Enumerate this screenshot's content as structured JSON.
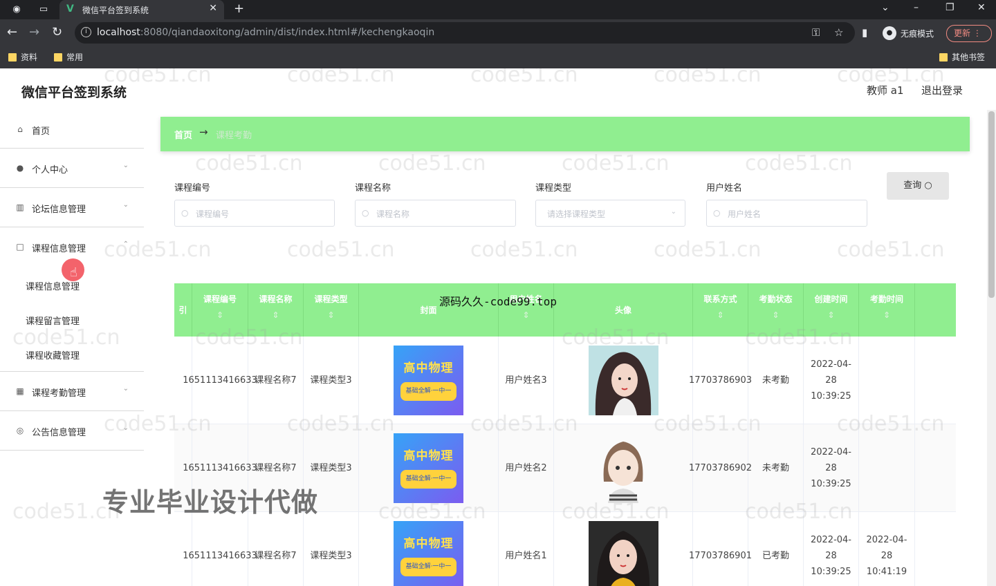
{
  "browser": {
    "tab_title": "微信平台签到系统",
    "url_host": "localhost",
    "url_rest": ":8080/qiandaoxitong/admin/dist/index.html#/kechengkaoqin",
    "incognito_label": "无痕模式",
    "update_label": "更新",
    "bookmarks": [
      "资料",
      "常用"
    ],
    "other_bookmarks": "其他书签"
  },
  "header": {
    "brand": "微信平台签到系统",
    "user": "教师 a1",
    "logout": "退出登录"
  },
  "sidebar": {
    "items": [
      {
        "label": "首页",
        "icon": "home-icon"
      },
      {
        "label": "个人中心",
        "icon": "user-icon"
      },
      {
        "label": "论坛信息管理",
        "icon": "chart-icon"
      },
      {
        "label": "课程信息管理",
        "icon": "square-icon"
      }
    ],
    "subitems": [
      "课程信息管理",
      "课程留言管理",
      "课程收藏管理"
    ],
    "items_after": [
      {
        "label": "课程考勤管理",
        "icon": "grid-icon"
      },
      {
        "label": "公告信息管理",
        "icon": "globe-icon"
      }
    ]
  },
  "breadcrumb": {
    "home": "首页",
    "arrow": "→",
    "current": "课程考勤"
  },
  "filters": {
    "course_no": {
      "label": "课程编号",
      "placeholder": "课程编号"
    },
    "course_name": {
      "label": "课程名称",
      "placeholder": "课程名称"
    },
    "course_type": {
      "label": "课程类型",
      "placeholder": "请选择课程类型"
    },
    "user_name": {
      "label": "用户姓名",
      "placeholder": "用户姓名"
    },
    "query": "查询"
  },
  "table": {
    "headers": [
      "引",
      "课程编号",
      "课程名称",
      "课程类型",
      "封面",
      "用户姓名",
      "头像",
      "联系方式",
      "考勤状态",
      "创建时间",
      "考勤时间"
    ],
    "rows": [
      {
        "course_no": "1651113416633",
        "course_name": "课程名称7",
        "course_type": "课程类型3",
        "cover_title": "高中物理",
        "cover_badge": "基础全解·一中一",
        "user_name": "用户姓名3",
        "phone": "17703786903",
        "status": "未考勤",
        "created": "2022-04-28 10:39:25",
        "checkin": ""
      },
      {
        "course_no": "1651113416633",
        "course_name": "课程名称7",
        "course_type": "课程类型3",
        "cover_title": "高中物理",
        "cover_badge": "基础全解·一中一",
        "user_name": "用户姓名2",
        "phone": "17703786902",
        "status": "未考勤",
        "created": "2022-04-28 10:39:25",
        "checkin": ""
      },
      {
        "course_no": "1651113416633",
        "course_name": "课程名称7",
        "course_type": "课程类型3",
        "cover_title": "高中物理",
        "cover_badge": "基础全解·一中一",
        "user_name": "用户姓名1",
        "phone": "17703786901",
        "status": "已考勤",
        "created": "2022-04-28 10:39:25",
        "checkin": "2022-04-28 10:41:19"
      }
    ]
  },
  "overlays": {
    "watermark": "code51.cn",
    "site_text": "源码久久-code99.top",
    "promo_text": "专业毕业设计代做"
  }
}
